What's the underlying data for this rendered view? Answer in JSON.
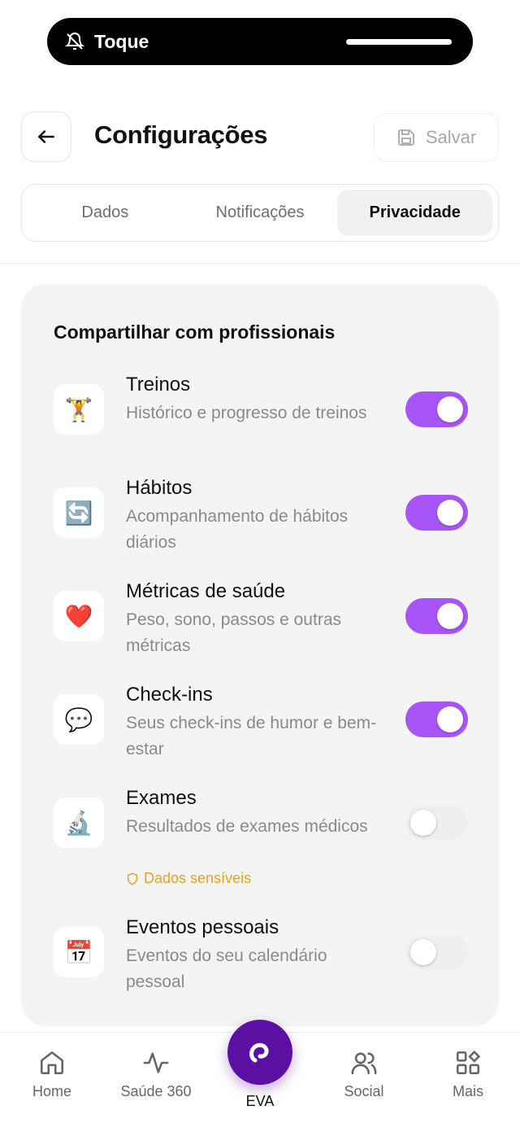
{
  "status": {
    "label": "Toque"
  },
  "header": {
    "title": "Configurações",
    "save_label": "Salvar"
  },
  "tabs": [
    {
      "label": "Dados",
      "active": false
    },
    {
      "label": "Notificações",
      "active": false
    },
    {
      "label": "Privacidade",
      "active": true
    }
  ],
  "section": {
    "title": "Compartilhar com profissionais",
    "items": [
      {
        "icon": "weightlifter-icon",
        "emoji": "🏋️",
        "name": "Treinos",
        "description": "Histórico e progresso de treinos",
        "enabled": true
      },
      {
        "icon": "refresh-icon",
        "emoji": "🔄",
        "name": "Hábitos",
        "description": "Acompanhamento de hábitos diários",
        "enabled": true
      },
      {
        "icon": "heart-icon",
        "emoji": "❤️",
        "name": "Métricas de saúde",
        "description": "Peso, sono, passos e outras métricas",
        "enabled": true
      },
      {
        "icon": "speech-bubble-icon",
        "emoji": "💬",
        "name": "Check-ins",
        "description": "Seus check-ins de humor e bem-estar",
        "enabled": true
      },
      {
        "icon": "microscope-icon",
        "emoji": "🔬",
        "name": "Exames",
        "description": "Resultados de exames médicos",
        "enabled": false,
        "warning": "Dados sensíveis"
      },
      {
        "icon": "calendar-icon",
        "emoji": "📅",
        "name": "Eventos pessoais",
        "description": "Eventos do seu calendário pessoal",
        "enabled": false
      }
    ]
  },
  "nav": {
    "items": [
      {
        "label": "Home",
        "icon": "home-icon"
      },
      {
        "label": "Saúde 360",
        "icon": "activity-icon"
      },
      {
        "label": "EVA",
        "icon": "eva-logo-icon"
      },
      {
        "label": "Social",
        "icon": "users-icon"
      },
      {
        "label": "Mais",
        "icon": "grid-icon"
      }
    ]
  },
  "colors": {
    "accent": "#a855f7",
    "brand": "#5b0fa3",
    "warning": "#e8a317"
  }
}
